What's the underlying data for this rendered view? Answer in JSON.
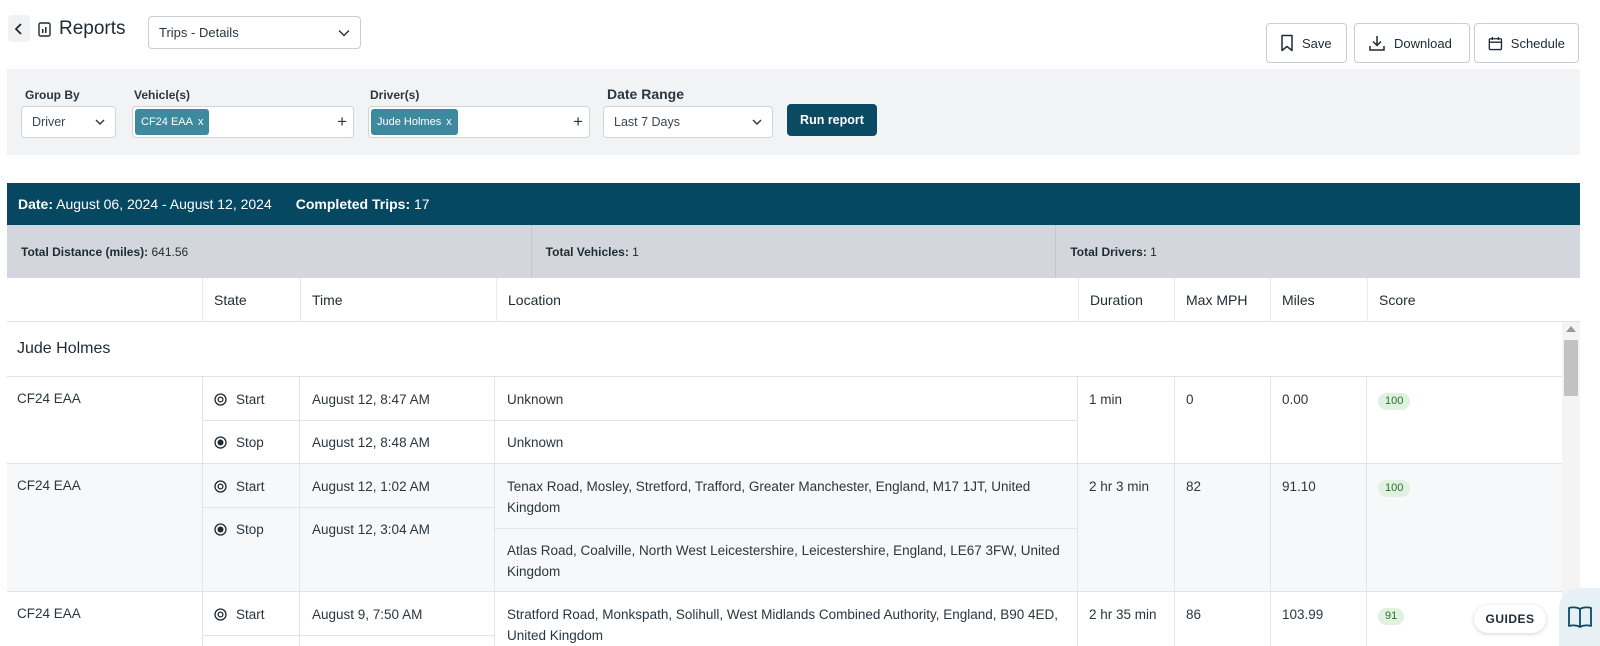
{
  "header": {
    "title": "Reports",
    "report_type": "Trips - Details",
    "save_label": "Save",
    "download_label": "Download",
    "schedule_label": "Schedule"
  },
  "filters": {
    "group_by_label": "Group By",
    "group_by_value": "Driver",
    "vehicles_label": "Vehicle(s)",
    "vehicle_chip": "CF24 EAA",
    "drivers_label": "Driver(s)",
    "driver_chip": "Jude Holmes",
    "chip_remove": "x",
    "add_symbol": "+",
    "date_range_label": "Date Range",
    "date_range_value": "Last 7 Days",
    "run_label": "Run report"
  },
  "summary": {
    "date_label": "Date:",
    "date_value": "August 06, 2024 - August 12, 2024",
    "completed_label": "Completed Trips:",
    "completed_value": "17",
    "total_distance_label": "Total Distance (miles):",
    "total_distance_value": "641.56",
    "total_vehicles_label": "Total Vehicles:",
    "total_vehicles_value": "1",
    "total_drivers_label": "Total Drivers:",
    "total_drivers_value": "1"
  },
  "table": {
    "columns": [
      "",
      "State",
      "Time",
      "Location",
      "Duration",
      "Max MPH",
      "Miles",
      "Score"
    ],
    "group_name": "Jude Holmes",
    "trips": [
      {
        "vehicle": "CF24 EAA",
        "start_state": "Start",
        "start_time": "August 12, 8:47 AM",
        "start_location": "Unknown",
        "stop_state": "Stop",
        "stop_time": "August 12, 8:48 AM",
        "stop_location": "Unknown",
        "duration": "1 min",
        "max_mph": "0",
        "miles": "0.00",
        "score": "100"
      },
      {
        "vehicle": "CF24 EAA",
        "start_state": "Start",
        "start_time": "August 12, 1:02 AM",
        "start_location": "Tenax Road, Mosley, Stretford, Trafford, Greater Manchester, England, M17 1JT, United Kingdom",
        "stop_state": "Stop",
        "stop_time": "August 12, 3:04 AM",
        "stop_location": "Atlas Road, Coalville, North West Leicestershire, Leicestershire, England, LE67 3FW, United Kingdom",
        "duration": "2 hr 3 min",
        "max_mph": "82",
        "miles": "91.10",
        "score": "100"
      },
      {
        "vehicle": "CF24 EAA",
        "start_state": "Start",
        "start_time": "August 9, 7:50 AM",
        "start_location": "Stratford Road, Monkspath, Solihull, West Midlands Combined Authority, England, B90 4ED, United Kingdom",
        "duration": "2 hr 35 min",
        "max_mph": "86",
        "miles": "103.99",
        "score": "91"
      }
    ]
  },
  "guides_label": "GUIDES",
  "colors": {
    "brand_dark": "#064761",
    "chip": "#3d8a9e",
    "run_button": "#0a4a62",
    "score_bg": "#dff1df"
  }
}
